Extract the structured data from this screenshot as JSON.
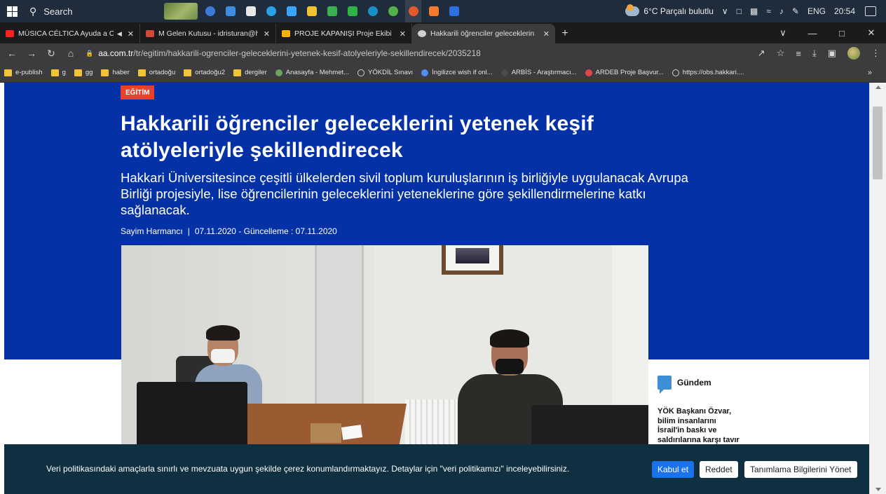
{
  "taskbar": {
    "search_placeholder": "Search",
    "weather_text": "6°C Parçalı bulutlu",
    "language": "ENG",
    "clock": "20:54",
    "app_colors": [
      "#3b7bd9",
      "#3f8de0",
      "#e8e8e8",
      "#2b9ee8",
      "#35a6ff",
      "#f1c232",
      "#37b24d",
      "#2fb344",
      "#1a8ec9",
      "#56b04a",
      "#e05a2b",
      "#f47a2d",
      "#2b6fe0"
    ]
  },
  "tabs": [
    {
      "title": "MÚSICA CÉLTICA Ayuda a C",
      "icon": "youtube-icon",
      "color": "#ff2020",
      "muted_icon": "speaker-icon"
    },
    {
      "title": "M Gelen Kutusu - idristuran@hakk",
      "icon": "gmail-icon",
      "color": "#d44638"
    },
    {
      "title": "PROJE KAPANIŞI Proje Ekibi - Go",
      "icon": "drive-icon",
      "color": "#f4b400"
    },
    {
      "title": "Hakkarili öğrenciler geleceklerin",
      "icon": "aa-icon",
      "color": "#d0d0d0"
    }
  ],
  "address": {
    "host": "aa.com.tr",
    "path": "/tr/egitim/hakkarili-ogrenciler-geleceklerini-yetenek-kesif-atolyeleriyle-sekillendirecek/2035218"
  },
  "bookmarks": [
    {
      "label": "e-publish",
      "icon": "folder-icon"
    },
    {
      "label": "g",
      "icon": "folder-icon"
    },
    {
      "label": "gg",
      "icon": "folder-icon"
    },
    {
      "label": "haber",
      "icon": "folder-icon"
    },
    {
      "label": "ortadoğu",
      "icon": "folder-icon"
    },
    {
      "label": "ortadoğu2",
      "icon": "folder-icon"
    },
    {
      "label": "dergiler",
      "icon": "folder-icon"
    },
    {
      "label": "Anasayfa - Mehmet...",
      "icon": "site-icon",
      "color": "#6fa060"
    },
    {
      "label": "YÖKDİL Sınavı",
      "icon": "globe-icon"
    },
    {
      "label": "İngilizce wish if onl...",
      "icon": "loading-icon",
      "color": "#4c8ff0"
    },
    {
      "label": "ARBİS - Araştırmacı...",
      "icon": "blank-icon",
      "color": "#4a4a4a"
    },
    {
      "label": "ARDEB Proje Başvur...",
      "icon": "pin-icon",
      "color": "#e04848"
    },
    {
      "label": "https://obs.hakkari....",
      "icon": "globe-icon"
    }
  ],
  "article": {
    "category": "EĞİTİM",
    "title": "Hakkarili öğrenciler geleceklerini yetenek keşif atölyeleriyle şekillendirecek",
    "summary": "Hakkari Üniversitesince çeşitli ülkelerden sivil toplum kuruluşlarının iş birliğiyle uygulanacak Avrupa Birliği projesiyle, lise öğrencilerinin geleceklerini yeteneklerine göre şekillendirmelerine katkı sağlanacak.",
    "author": "Sayim Harmancı",
    "separator": "|",
    "dates": "07.11.2020 - Güncelleme : 07.11.2020"
  },
  "sidebar": {
    "section_label": "Gündem",
    "news": "YÖK Başkanı Özvar, bilim insanlarını İsrail'in baskı ve saldırılarına karşı tavır almaya"
  },
  "cookie": {
    "message": "Veri politikasındaki amaçlarla sınırlı ve mevzuata uygun şekilde çerez konumlandırmaktayız. Detaylar için \"veri politikamızı\" inceleyebilirsiniz.",
    "accept_label": "Kabul et",
    "reject_label": "Reddet",
    "manage_label": "Tanımlama Bilgilerini Yönet"
  },
  "colors": {
    "hero_bg": "#0432a6",
    "category_badge": "#e8412c",
    "cookie_bg": "#0e3040",
    "accept_btn": "#1a73e8"
  }
}
